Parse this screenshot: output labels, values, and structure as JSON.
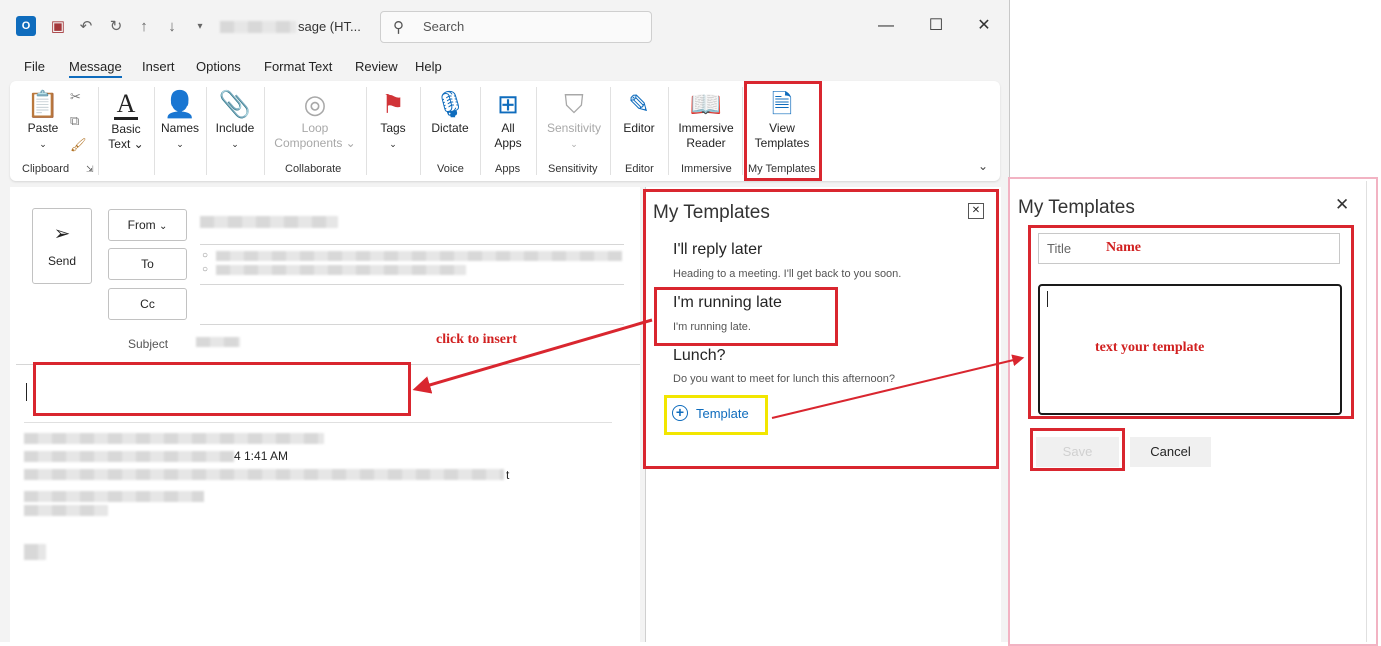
{
  "window": {
    "title_suffix": "sage (HT...",
    "search_placeholder": "Search",
    "controls": {
      "minimize": "—",
      "maximize": "☐",
      "close": "✕"
    }
  },
  "menu": [
    "File",
    "Message",
    "Insert",
    "Options",
    "Format Text",
    "Review",
    "Help"
  ],
  "ribbon": {
    "paste": "Paste",
    "basic_text": "Basic\nText",
    "names": "Names",
    "include": "Include",
    "loop": "Loop\nComponents",
    "tags": "Tags",
    "dictate": "Dictate",
    "all_apps": "All\nApps",
    "sensitivity": "Sensitivity",
    "editor": "Editor",
    "immersive_reader": "Immersive\nReader",
    "view_templates": "View\nTemplates",
    "groups": {
      "clipboard": "Clipboard",
      "collaborate": "Collaborate",
      "voice": "Voice",
      "apps": "Apps",
      "sensitivity": "Sensitivity",
      "editor": "Editor",
      "immersive": "Immersive",
      "my_templates": "My Templates"
    }
  },
  "compose": {
    "send": "Send",
    "from": "From",
    "to": "To",
    "cc": "Cc",
    "subject": "Subject",
    "quoted_time": "4 1:41 AM",
    "quoted_tail": "t"
  },
  "annotations": {
    "click_to_insert": "click to insert",
    "name": "Name",
    "text_your_template": "text your template"
  },
  "templates_pane": {
    "title": "My Templates",
    "close": "✕",
    "items": [
      {
        "title": "I'll reply later",
        "body": "Heading to a meeting. I'll get back to you soon."
      },
      {
        "title": "I'm running late",
        "body": "I'm running late."
      },
      {
        "title": "Lunch?",
        "body": "Do you want to meet for lunch this afternoon?"
      }
    ],
    "add_template": "Template"
  },
  "dialog": {
    "title": "My Templates",
    "close": "✕",
    "title_placeholder": "Title",
    "save": "Save",
    "cancel": "Cancel"
  },
  "colors": {
    "accent": "#0f6cbd",
    "annotation_red": "#d9262f",
    "highlight_yellow": "#f2e600",
    "dialog_border": "#f2b3c3"
  }
}
